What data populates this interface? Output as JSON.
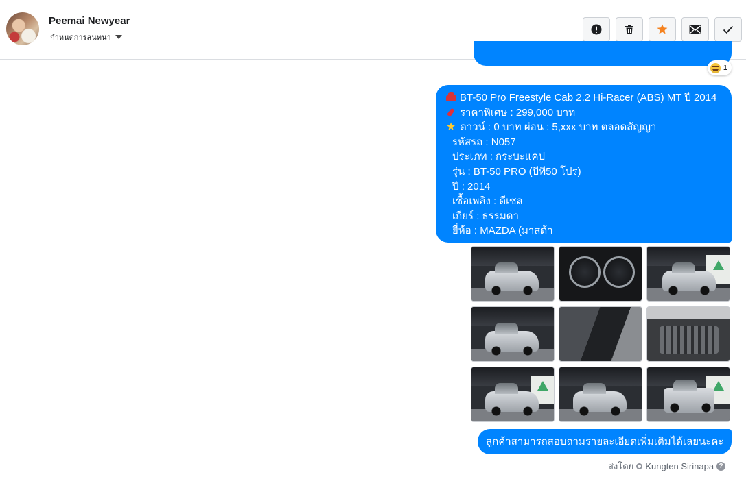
{
  "header": {
    "contact_name": "Peemai Newyear",
    "assign_label": "กำหนดการสนทนา",
    "actions": [
      {
        "name": "spam-button",
        "icon": "exclamation-icon"
      },
      {
        "name": "delete-button",
        "icon": "trash-icon"
      },
      {
        "name": "star-button",
        "icon": "star-icon",
        "color": "#f5821f"
      },
      {
        "name": "mark-unread-button",
        "icon": "envelope-icon"
      },
      {
        "name": "mark-done-button",
        "icon": "check-icon"
      }
    ]
  },
  "previous_message": {
    "reaction_emoji": "laughing-emoji",
    "reaction_count": "1"
  },
  "message": {
    "lines": [
      {
        "icon": "car-icon",
        "text": "BT-50 Pro Freestyle Cab 2.2 Hi-Racer (ABS) MT ปี 2014"
      },
      {
        "icon": "pushpin-icon",
        "text": "ราคาพิเศษ : 299,000 บาท"
      },
      {
        "icon": "star-icon",
        "text": "ดาวน์ : 0 บาท ผ่อน : 5,xxx บาท ตลอดสัญญา"
      },
      {
        "icon": "",
        "text": "รหัสรถ : N057"
      },
      {
        "icon": "",
        "text": "ประเภท : กระบะแคป"
      },
      {
        "icon": "",
        "text": "รุ่น : BT-50 PRO (บีที50 โปร)"
      },
      {
        "icon": "",
        "text": "ปี : 2014"
      },
      {
        "icon": "",
        "text": "เชื้อเพลิง : ดีเซล"
      },
      {
        "icon": "",
        "text": "เกียร์ : ธรรมดา"
      },
      {
        "icon": "",
        "text": "ยี่ห้อ : MAZDA (มาสด้า"
      }
    ],
    "bubble_color": "#0084ff"
  },
  "photos": [
    {
      "subject": "car-rear-side"
    },
    {
      "subject": "dashboard-gauges"
    },
    {
      "subject": "car-front"
    },
    {
      "subject": "car-front-side"
    },
    {
      "subject": "interior-seats"
    },
    {
      "subject": "engine-bay"
    },
    {
      "subject": "car-front-side"
    },
    {
      "subject": "car-rear-side"
    },
    {
      "subject": "car-rear"
    }
  ],
  "closing_message": "ลูกค้าสามารถสอบถามรายละเอียดเพิ่มเติมได้เลยนะคะ",
  "footer": {
    "sent_by_label": "ส่งโดย",
    "sender_name": "Kungten Sirinapa",
    "help_glyph": "?"
  }
}
